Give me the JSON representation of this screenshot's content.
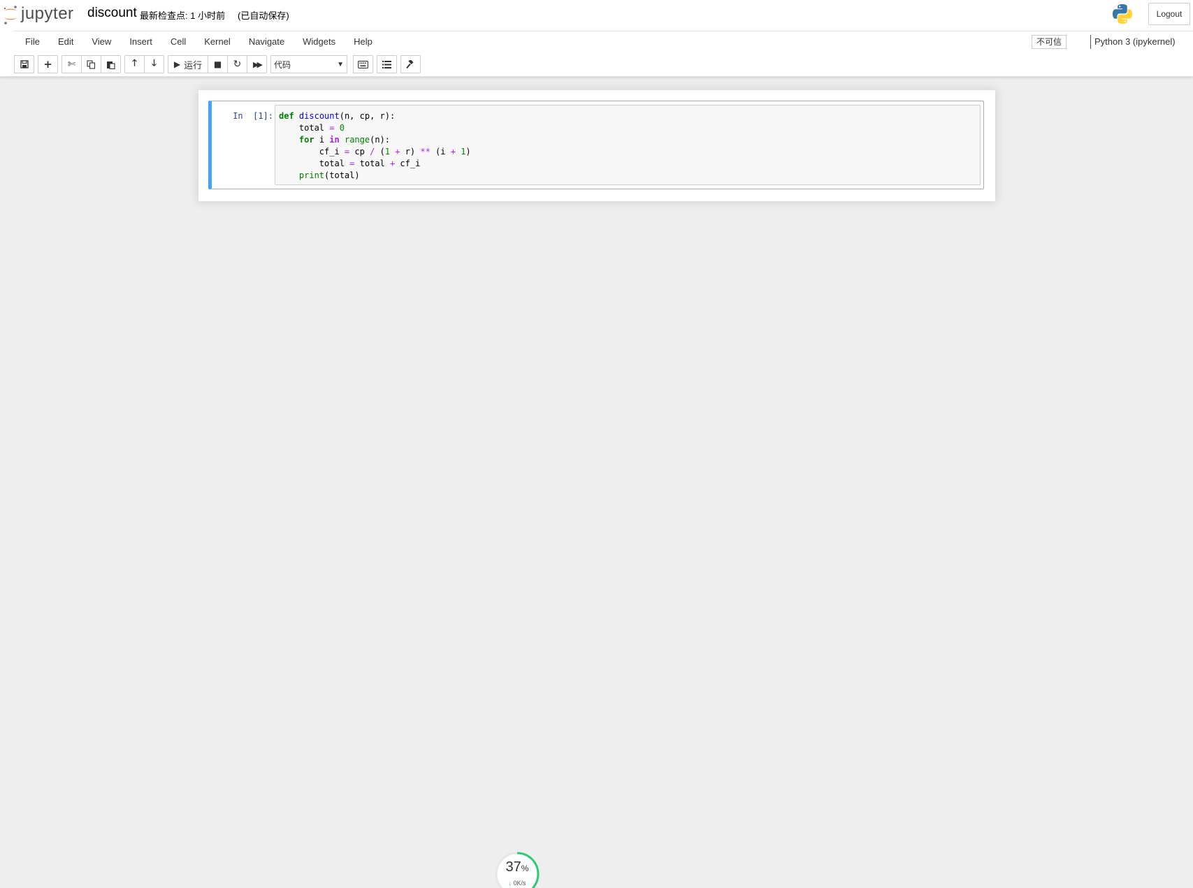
{
  "header": {
    "logo_text": "jupyter",
    "notebook_name": "discount",
    "checkpoint": "最新检查点: 1 小时前",
    "autosave": "(已自动保存)",
    "logout_label": "Logout"
  },
  "menubar": {
    "items": [
      "File",
      "Edit",
      "View",
      "Insert",
      "Cell",
      "Kernel",
      "Navigate",
      "Widgets",
      "Help"
    ],
    "trust_label": "不可信",
    "kernel_name": "Python 3 (ipykernel)"
  },
  "toolbar": {
    "run_label": "运行",
    "cell_type": "代码"
  },
  "cells": [
    {
      "prompt": "In  [1]:",
      "type": "code"
    }
  ],
  "speed_widget": {
    "percent": "37",
    "percent_sign": "%",
    "rate": "0K/s",
    "percent_value": 37
  },
  "colors": {
    "accent": "#42a5f5",
    "logo_orange": "#f37726",
    "prompt": "#303f9f",
    "keyword": "#008000",
    "function": "#0000ff",
    "operator": "#aa22ff"
  }
}
